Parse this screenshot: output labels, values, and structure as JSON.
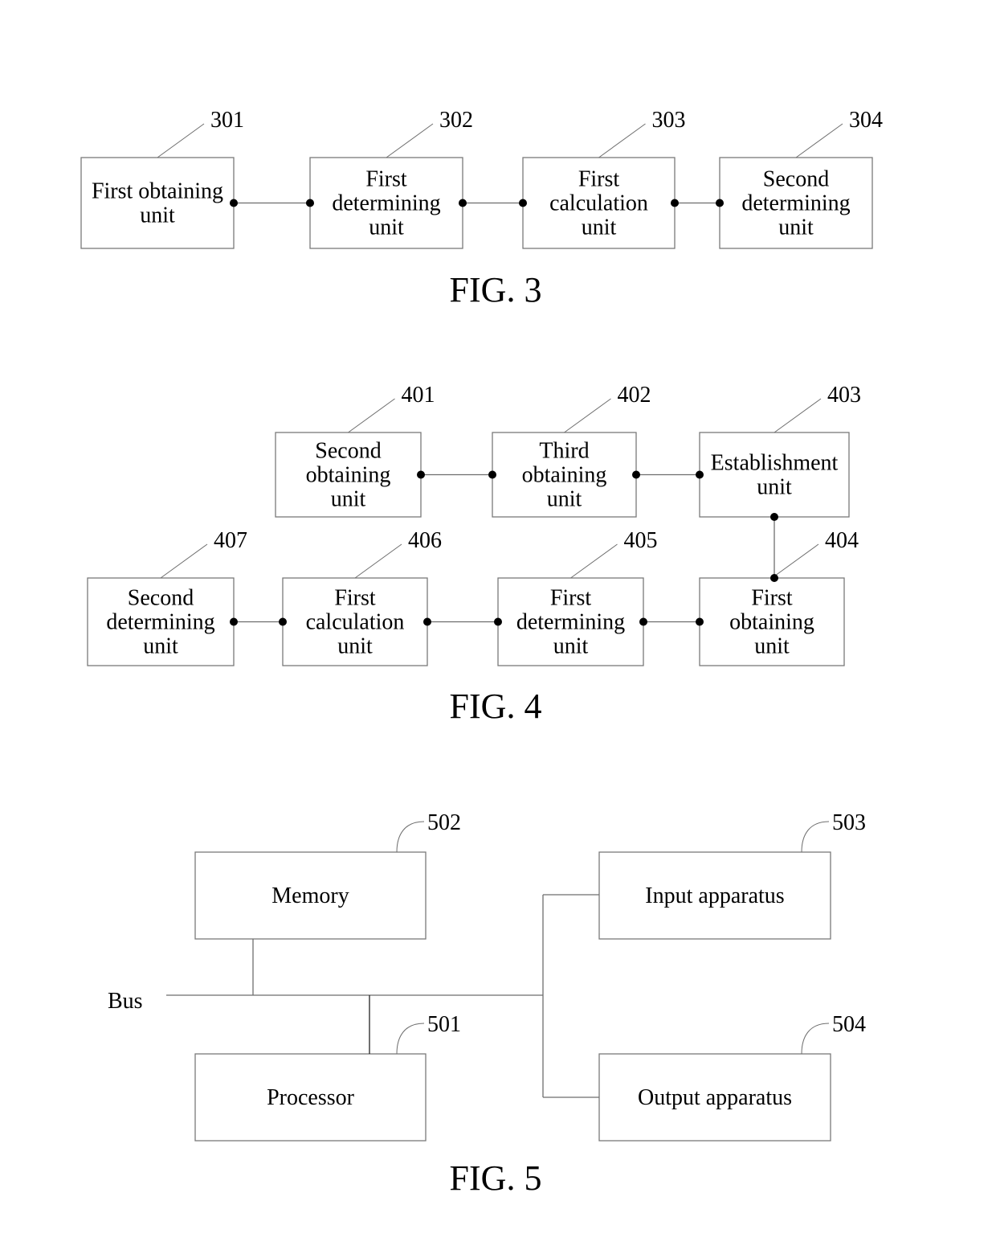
{
  "figures": {
    "fig3": {
      "caption": "FIG. 3",
      "units": [
        {
          "ref": "301",
          "lines": [
            "First obtaining",
            "unit"
          ]
        },
        {
          "ref": "302",
          "lines": [
            "First",
            "determining",
            "unit"
          ]
        },
        {
          "ref": "303",
          "lines": [
            "First",
            "calculation",
            "unit"
          ]
        },
        {
          "ref": "304",
          "lines": [
            "Second",
            "determining",
            "unit"
          ]
        }
      ],
      "connections": [
        [
          "301",
          "302"
        ],
        [
          "302",
          "303"
        ],
        [
          "303",
          "304"
        ]
      ]
    },
    "fig4": {
      "caption": "FIG. 4",
      "units": [
        {
          "ref": "401",
          "lines": [
            "Second",
            "obtaining",
            "unit"
          ]
        },
        {
          "ref": "402",
          "lines": [
            "Third",
            "obtaining",
            "unit"
          ]
        },
        {
          "ref": "403",
          "lines": [
            "Establishment",
            "unit"
          ]
        },
        {
          "ref": "404",
          "lines": [
            "First",
            "obtaining",
            "unit"
          ]
        },
        {
          "ref": "405",
          "lines": [
            "First",
            "determining",
            "unit"
          ]
        },
        {
          "ref": "406",
          "lines": [
            "First",
            "calculation",
            "unit"
          ]
        },
        {
          "ref": "407",
          "lines": [
            "Second",
            "determining",
            "unit"
          ]
        }
      ],
      "connections": [
        [
          "401",
          "402"
        ],
        [
          "402",
          "403"
        ],
        [
          "403",
          "404"
        ],
        [
          "405",
          "404"
        ],
        [
          "406",
          "405"
        ],
        [
          "407",
          "406"
        ]
      ]
    },
    "fig5": {
      "caption": "FIG. 5",
      "bus_label": "Bus",
      "units": [
        {
          "ref": "502",
          "lines": [
            "Memory"
          ]
        },
        {
          "ref": "501",
          "lines": [
            "Processor"
          ]
        },
        {
          "ref": "503",
          "lines": [
            "Input apparatus"
          ]
        },
        {
          "ref": "504",
          "lines": [
            "Output apparatus"
          ]
        }
      ]
    }
  }
}
